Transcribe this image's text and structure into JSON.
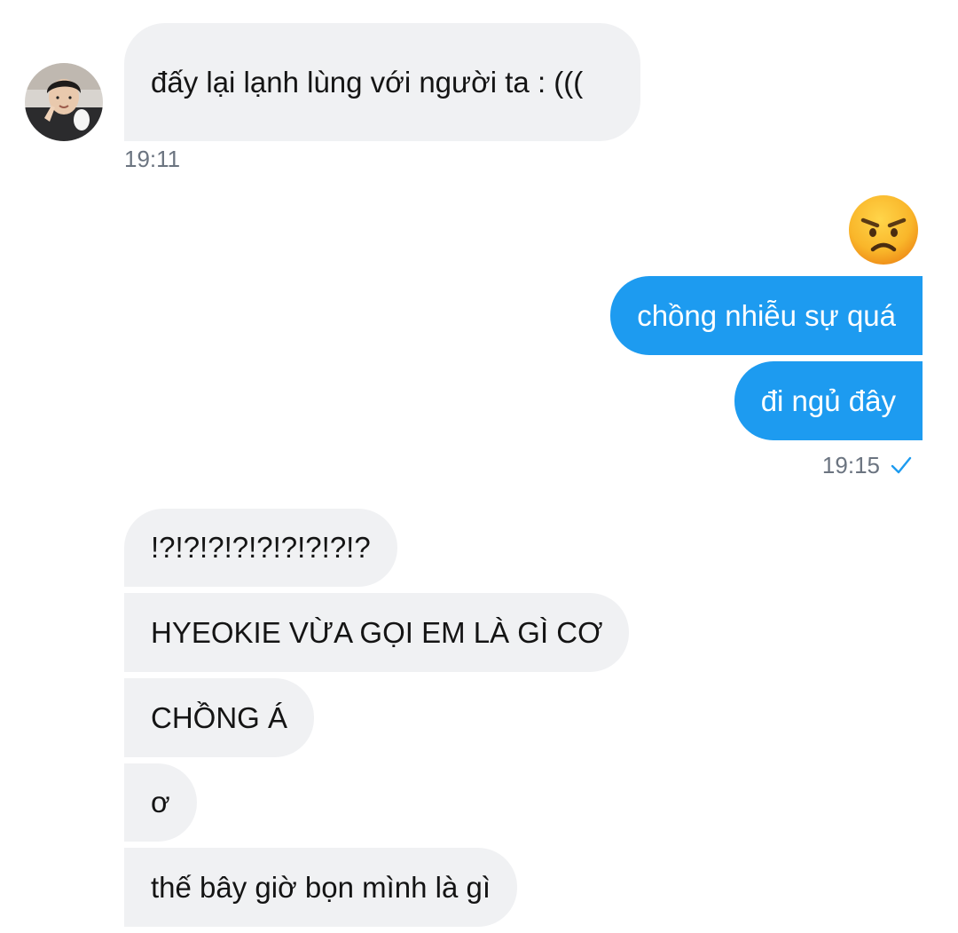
{
  "conversation": {
    "incoming_first": {
      "text": "đấy lại lạnh lùng với người ta : (((",
      "time": "19:11"
    },
    "outgoing": {
      "reaction_emoji": "angry-face",
      "messages": [
        "chồng nhiễu sự quá",
        "đi ngủ đây"
      ],
      "time": "19:15",
      "status_icon": "check-icon"
    },
    "incoming_second": {
      "messages": [
        "!?!?!?!?!?!?!?!?!?",
        "HYEOKIE VỪA GỌI EM LÀ GÌ CƠ",
        "CHỒNG Á",
        "ơ",
        "thế bây giờ bọn mình là gì"
      ]
    }
  },
  "colors": {
    "incoming_bubble": "#f0f1f3",
    "outgoing_bubble": "#1d9bf0",
    "timestamp": "#6b7480",
    "check": "#1d9bf0"
  }
}
